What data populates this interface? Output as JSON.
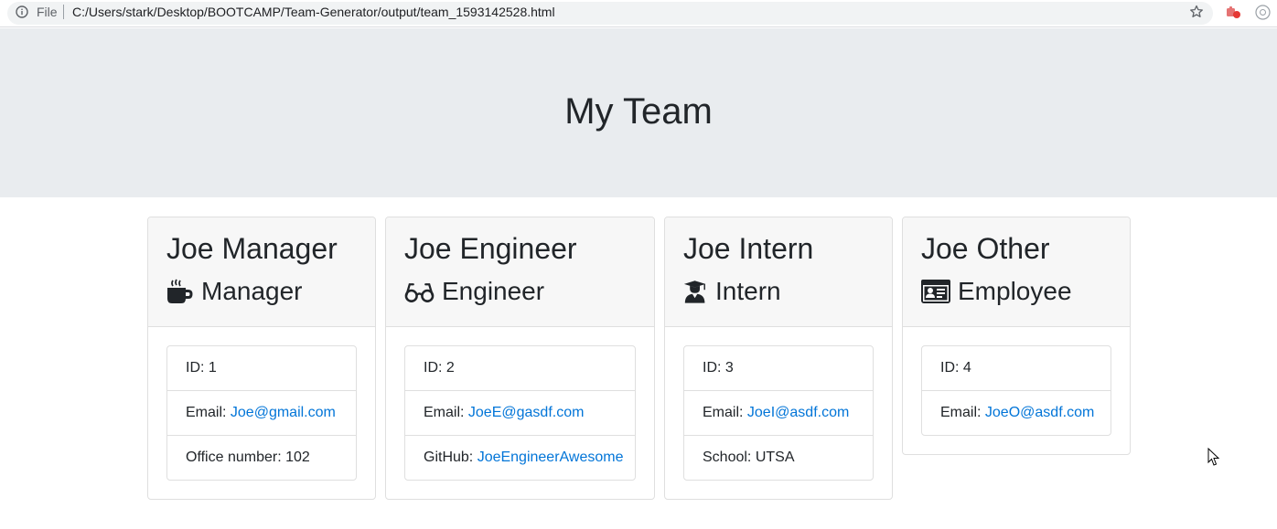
{
  "browser": {
    "file_label": "File",
    "url": "C:/Users/stark/Desktop/BOOTCAMP/Team-Generator/output/team_1593142528.html",
    "icons": [
      "info-icon",
      "star-icon",
      "extension-icon",
      "profile-icon"
    ]
  },
  "page": {
    "title": "My Team"
  },
  "cards": [
    {
      "name": "Joe Manager",
      "role": "Manager",
      "role_icon": "coffee-mug-icon",
      "id_label": "ID: 1",
      "email_label": "Email: ",
      "email": "Joe@gmail.com",
      "extra_label": "Office number: 102"
    },
    {
      "name": "Joe Engineer",
      "role": "Engineer",
      "role_icon": "glasses-icon",
      "id_label": "ID: 2",
      "email_label": "Email: ",
      "email": "JoeE@gasdf.com",
      "extra_label": "GitHub: ",
      "extra_link": "JoeEngineerAwesome"
    },
    {
      "name": "Joe Intern",
      "role": "Intern",
      "role_icon": "graduate-icon",
      "id_label": "ID: 3",
      "email_label": "Email: ",
      "email": "JoeI@asdf.com",
      "extra_label": "School: UTSA"
    },
    {
      "name": "Joe Other",
      "role": "Employee",
      "role_icon": "id-card-icon",
      "id_label": "ID: 4",
      "email_label": "Email: ",
      "email": "JoeO@asdf.com"
    }
  ],
  "colors": {
    "jumbotron": "#e9ecef",
    "card_header": "#f7f7f7",
    "link": "#0275d8",
    "text": "#212529"
  }
}
